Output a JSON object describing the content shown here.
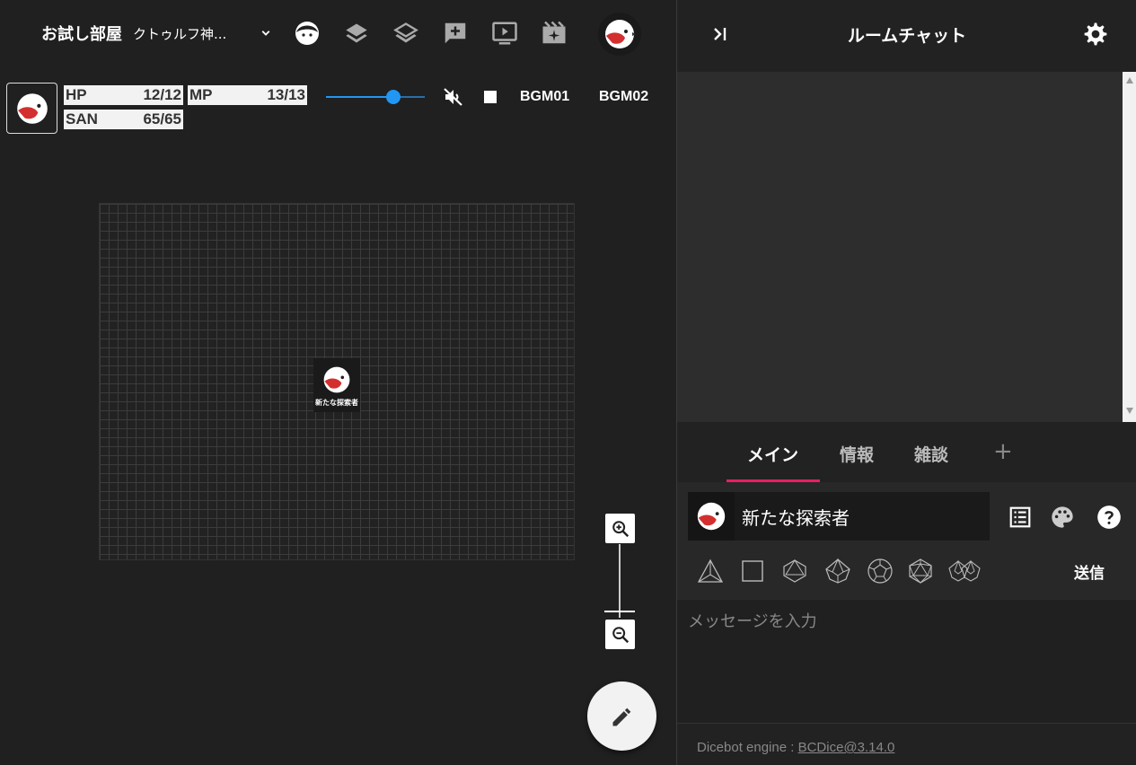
{
  "header": {
    "room_name": "お試し部屋",
    "room_system": "クトゥルフ神...",
    "icons": [
      "chevron-down-icon",
      "face-icon",
      "layers-filled-icon",
      "layers-outline-icon",
      "add-comment-icon",
      "screen-play-icon",
      "movie-sparkle-icon",
      "user-avatar-icon"
    ]
  },
  "character": {
    "avatar_icon": "bird-head-icon",
    "stats": [
      {
        "label": "HP",
        "value": "12/12"
      },
      {
        "label": "MP",
        "value": "13/13"
      },
      {
        "label": "SAN",
        "value": "65/65"
      }
    ]
  },
  "audio": {
    "volume_percent": 68,
    "muted_icon": "volume-off-icon",
    "stop_icon": "stop-icon",
    "bgm1": "BGM01",
    "bgm2": "BGM02"
  },
  "board": {
    "token_label": "新たな探索者"
  },
  "chat": {
    "title": "ルームチャット",
    "collapse_icon": "collapse-right-icon",
    "settings_icon": "gear-icon",
    "tabs": [
      {
        "label": "メイン",
        "active": true
      },
      {
        "label": "情報",
        "active": false
      },
      {
        "label": "雑談",
        "active": false
      }
    ],
    "add_tab": "+",
    "character_name": "新たな探索者",
    "send_label": "送信",
    "input_placeholder": "メッセージを入力",
    "dice_icons": [
      "d4-icon",
      "d6-icon",
      "d8-icon",
      "d10-icon",
      "d12-icon",
      "d20-icon",
      "d100-icon"
    ],
    "footer_prefix": "Dicebot engine : ",
    "footer_link": "BCDice@3.14.0"
  },
  "colors": {
    "accent_blue": "#2196f3",
    "tab_underline": "#e91e63",
    "bg_dark": "#202020"
  }
}
